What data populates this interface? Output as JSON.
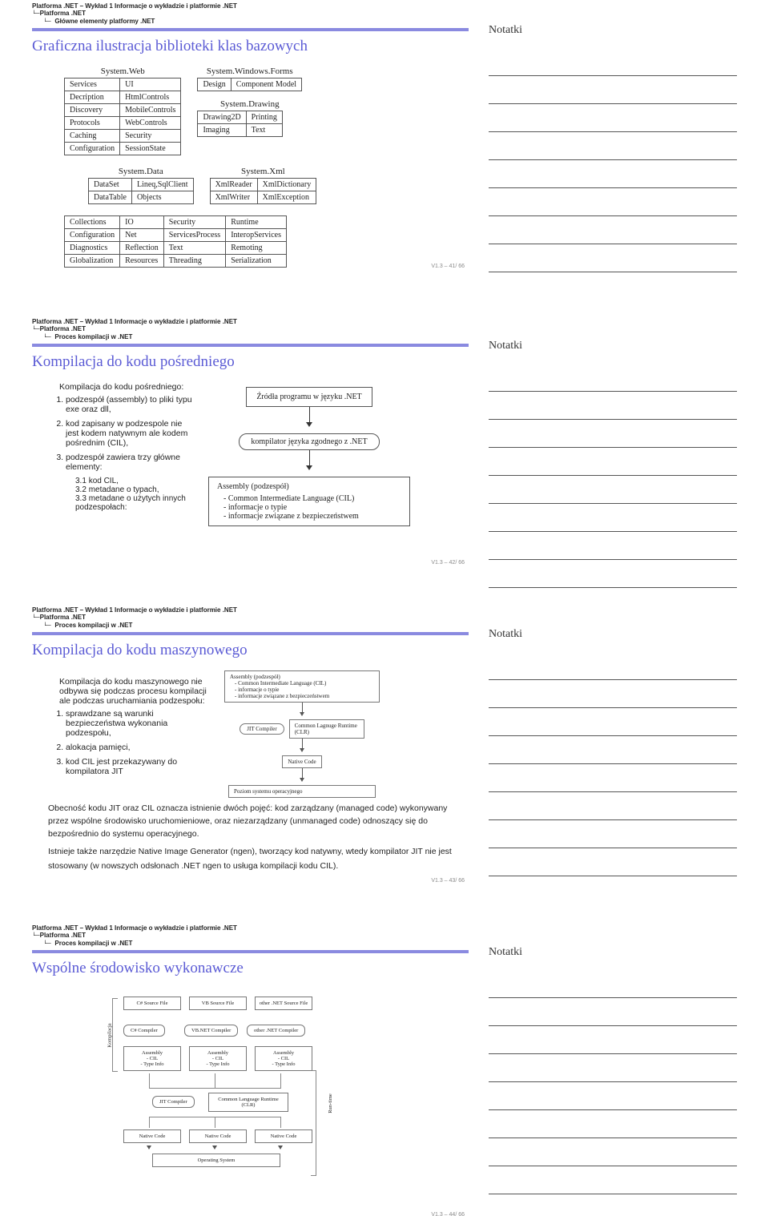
{
  "common": {
    "bc_top": "Platforma .NET – Wykład 1  Informacje o wykładzie i platformie .NET",
    "bc_mid": "Platforma .NET",
    "bc_41": "Główne elementy platformy .NET",
    "bc_42": "Proces kompilacji w .NET",
    "notes_title": "Notatki",
    "version": "V1.3 –",
    "total": "/ 66"
  },
  "slide41": {
    "title": "Graficzna ilustracja biblioteki klas bazowych",
    "page": "41",
    "sys_web": "System.Web",
    "sys_winforms": "System.Windows.Forms",
    "sys_drawing": "System.Drawing",
    "sys_data": "System.Data",
    "sys_xml": "System.Xml",
    "web": {
      "c1": [
        "Services",
        "  Decription",
        "  Discovery",
        "  Protocols",
        "Caching",
        "Configuration"
      ],
      "c2": [
        "UI",
        "  HtmlControls",
        "  MobileControls",
        "  WebControls",
        "Security",
        "SessionState"
      ]
    },
    "forms": {
      "design": "Design",
      "component": "Component Model"
    },
    "drawing": {
      "r1c1": "Drawing2D",
      "r1c2": "Printing",
      "r2c1": "Imaging",
      "r2c2": "Text"
    },
    "data": {
      "r1c1": "DataSet",
      "r1c2": "Lineq,SqlClient",
      "r2c1": "DataTable",
      "r2c2": "Objects"
    },
    "xml": {
      "r1c1": "XmlReader",
      "r1c2": "XmlDictionary",
      "r2c1": "XmlWriter",
      "r2c2": "XmlException"
    },
    "bottom": {
      "c1": [
        "Collections",
        "Configuration",
        "Diagnostics",
        "Globalization"
      ],
      "c2": [
        "IO",
        "Net",
        "Reflection",
        "Resources"
      ],
      "c3": [
        "Security",
        "ServicesProcess",
        "Text",
        "Threading"
      ],
      "c4": [
        "Runtime",
        "InteropServices",
        "Remoting",
        "Serialization"
      ]
    }
  },
  "slide42": {
    "title": "Kompilacja do kodu pośredniego",
    "page": "42",
    "intro": "Kompilacja do kodu pośredniego:",
    "item1": "podzespół (assembly) to pliki typu exe oraz dll,",
    "item2": "kod zapisany w podzespole nie jest kodem natywnym ale kodem pośrednim (CIL),",
    "item3": "podzespół zawiera trzy główne elementy:",
    "sub1": "kod CIL,",
    "sub2": "metadane o typach,",
    "sub3": "metadane o użytych innych podzespołach:",
    "box_src": "Źródła programu w języku .NET",
    "box_comp": "kompilator języka zgodnego z .NET",
    "box_asm_title": "Assembly (podzespół)",
    "box_asm_l1": "- Common Intermediate Language (CIL)",
    "box_asm_l2": "- informacje o typie",
    "box_asm_l3": "- informacje związane z bezpieczeństwem"
  },
  "slide43": {
    "title": "Kompilacja do kodu maszynowego",
    "page": "43",
    "intro": "Kompilacja do kodu maszynowego nie odbywa się podczas procesu kompilacji ale podczas uruchamiania podzespołu:",
    "i1": "sprawdzane są warunki bezpieczeństwa wykonania podzespołu,",
    "i2": "alokacja pamięci,",
    "i3": "kod CIL jest przekazywany do kompilatora JIT",
    "asm_title": "Assembly (podzespół)",
    "asm_l1": "- Common Intermediate Language (CIL)",
    "asm_l2": "- informacje o typie",
    "asm_l3": "- informacje związane z bezpieczeństwem",
    "jit": "JIT Compiler",
    "clr": "Common     Lagnuge Runtime (CLR)",
    "native": "Native Code",
    "os": "Poziom systemu operacyjnego",
    "para1": "Obecność kodu JIT oraz CIL oznacza istnienie dwóch pojęć: kod zarządzany (managed code) wykonywany przez wspólne środowisko uruchomieniowe, oraz niezarządzany (unmanaged code) odnoszący się do bezpośrednio do systemu operacyjnego.",
    "para2": "Istnieje także narzędzie Native Image Generator (ngen), tworzący kod natywny, wtedy kompilator JIT nie jest stosowany (w nowszych odsłonach .NET ngen to usługa kompilacji kodu CIL)."
  },
  "slide44": {
    "title": "Wspólne środowisko wykonawcze",
    "page": "44",
    "src1": "C# Source File",
    "src2": "VB Source File",
    "src3": "other .NET Source File",
    "comp1": "C# Compiler",
    "comp2": "VB.NET Compiler",
    "comp3": "other .NET Compiler",
    "asm_label": "Assembly",
    "asm_l1": "- CIL",
    "asm_l2": "- Type Info",
    "jit": "JIT Compiler",
    "clr": "Common Language Runtime (CLR)",
    "native": "Native Code",
    "os": "Operating System",
    "rot_left": "Kompilacja",
    "rot_right": "Run-time"
  }
}
